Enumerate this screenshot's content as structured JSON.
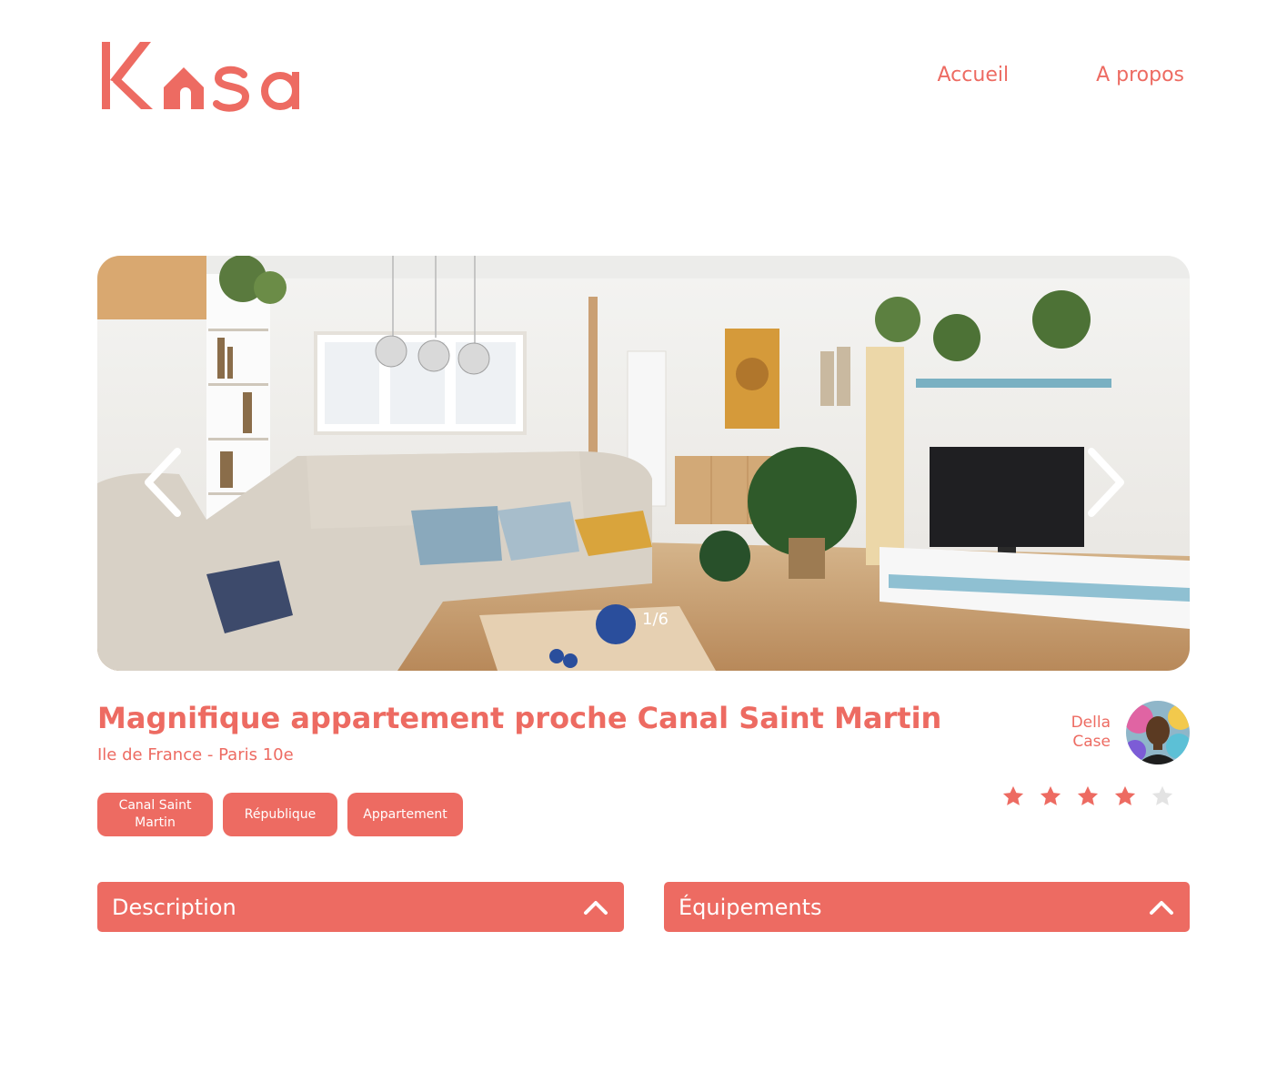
{
  "header": {
    "logo_text": "Kasa",
    "nav": [
      {
        "label": "Accueil"
      },
      {
        "label": "A propos"
      }
    ]
  },
  "carousel": {
    "current": 1,
    "total": 6,
    "counter_text": "1/6"
  },
  "listing": {
    "title": "Magnifique appartement proche Canal Saint Martin",
    "location": "Ile de France - Paris 10e",
    "tags": [
      "Canal Saint Martin",
      "République",
      "Appartement"
    ],
    "host": {
      "first_name": "Della",
      "last_name": "Case"
    },
    "rating": 4,
    "rating_max": 5
  },
  "sections": {
    "description_label": "Description",
    "equipments_label": "Équipements"
  },
  "colors": {
    "brand": "#ED6B62",
    "star_inactive": "#E3E3E3",
    "text_on_brand": "#FFFFFF"
  }
}
